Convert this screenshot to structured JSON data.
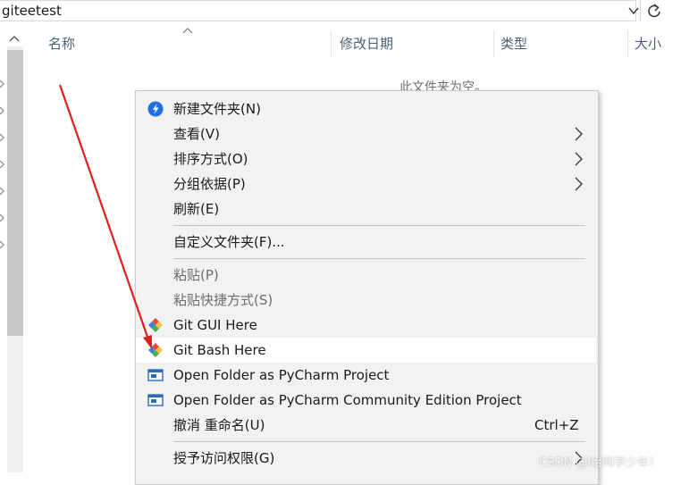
{
  "address_bar": {
    "path": "giteetest"
  },
  "columns": [
    {
      "label": "名称"
    },
    {
      "label": "修改日期"
    },
    {
      "label": "类型"
    },
    {
      "label": "大小"
    }
  ],
  "empty_message": "此文件夹为空。",
  "context_menu": {
    "items": [
      {
        "label": "新建文件夹(N)",
        "icon": "new-folder-icon"
      },
      {
        "label": "查看(V)",
        "submenu": true
      },
      {
        "label": "排序方式(O)",
        "submenu": true
      },
      {
        "label": "分组依据(P)",
        "submenu": true
      },
      {
        "label": "刷新(E)"
      },
      {
        "label": "自定义文件夹(F)..."
      },
      {
        "label": "粘贴(P)",
        "disabled": true
      },
      {
        "label": "粘贴快捷方式(S)",
        "disabled": true
      },
      {
        "label": "Git GUI Here",
        "icon": "git-gui-icon"
      },
      {
        "label": "Git Bash Here",
        "icon": "git-bash-icon",
        "highlighted": true
      },
      {
        "label": "Open Folder as PyCharm Project",
        "icon": "pycharm-icon"
      },
      {
        "label": "Open Folder as PyCharm Community Edition Project",
        "icon": "pycharm-icon"
      },
      {
        "label": "撤消 重命名(U)",
        "shortcut": "Ctrl+Z"
      },
      {
        "label": "授予访问权限(G)",
        "submenu": true
      }
    ]
  },
  "watermark": "CSDN @Ⅰ怡同学少年！",
  "colors": {
    "menu_bg": "#f2f2f2",
    "highlight_bg": "#ffffff",
    "annotation_arrow": "#e02020",
    "header_text": "#4c607a",
    "disabled_text": "#6d6d6d"
  }
}
